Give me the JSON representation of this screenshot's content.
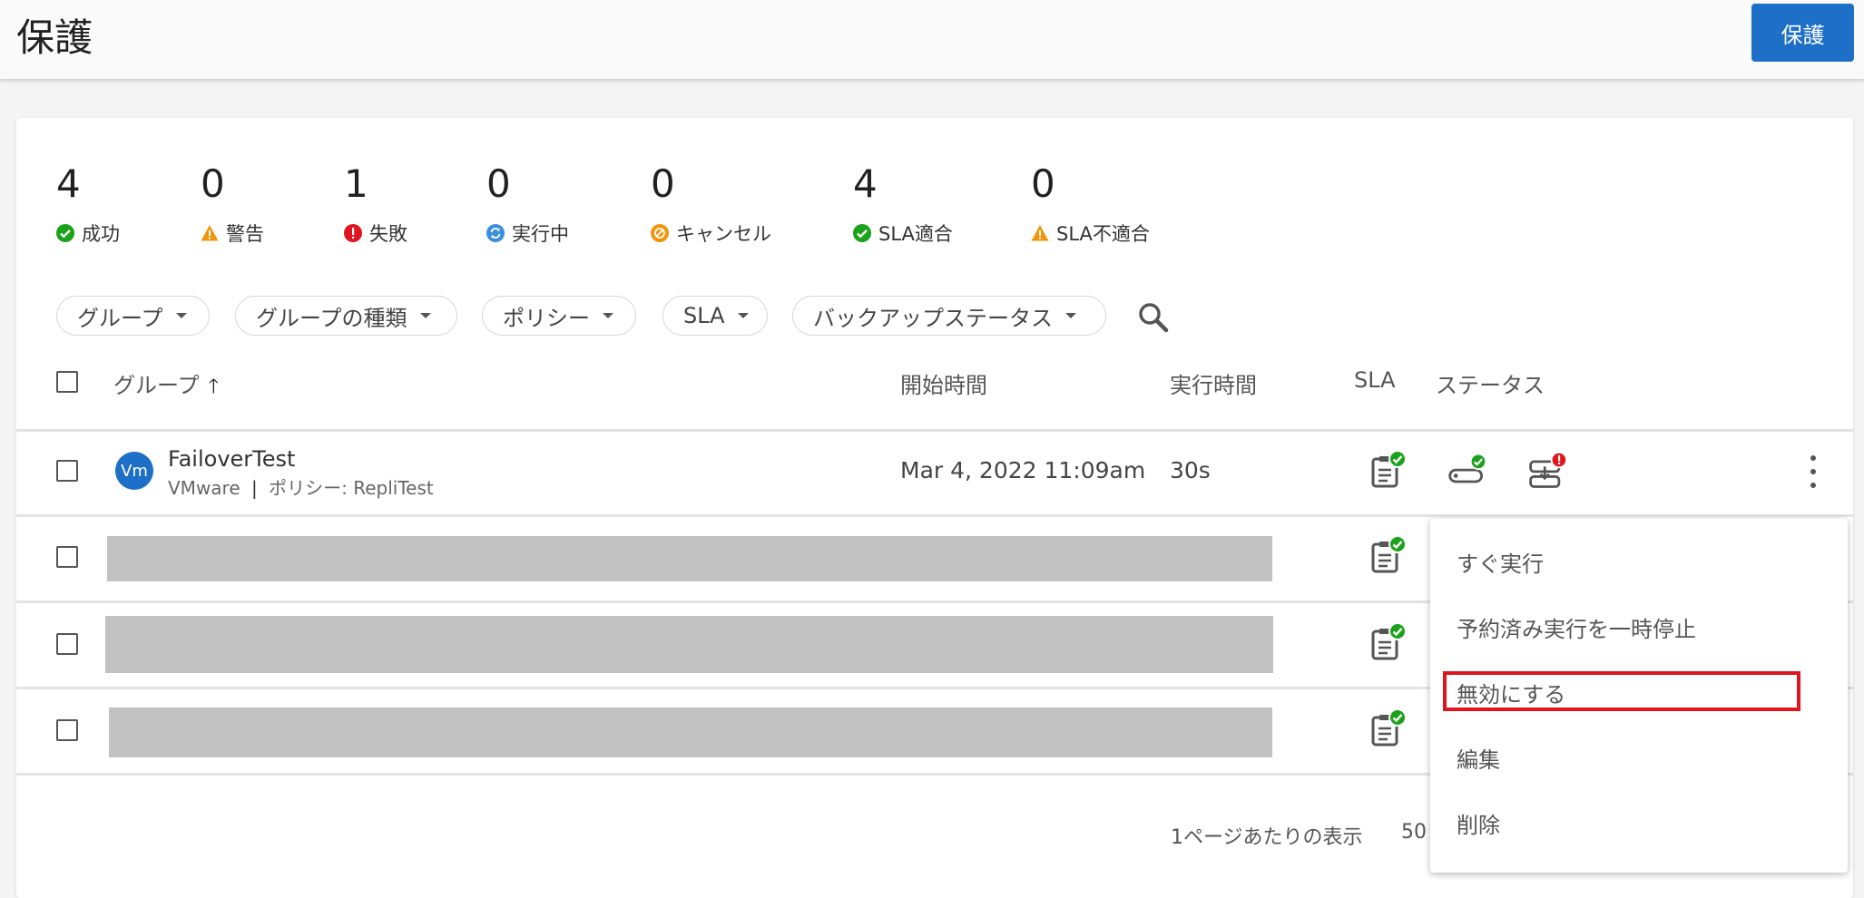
{
  "header": {
    "title": "保護",
    "protect_button": "保護",
    "brand_color": "#1d6fc7"
  },
  "stats": [
    {
      "value": "4",
      "label": "成功",
      "icon": "success-check-icon",
      "color": "#1aa31a"
    },
    {
      "value": "0",
      "label": "警告",
      "icon": "warning-icon",
      "color": "#f0960e"
    },
    {
      "value": "1",
      "label": "失敗",
      "icon": "error-icon",
      "color": "#e0151f"
    },
    {
      "value": "0",
      "label": "実行中",
      "icon": "running-sync-icon",
      "color": "#3d8fdb"
    },
    {
      "value": "0",
      "label": "キャンセル",
      "icon": "cancelled-icon",
      "color": "#f0960e"
    },
    {
      "value": "4",
      "label": "SLA適合",
      "icon": "sla-met-check-icon",
      "color": "#1aa31a"
    },
    {
      "value": "0",
      "label": "SLA不適合",
      "icon": "sla-not-met-warning-icon",
      "color": "#f0960e"
    }
  ],
  "filters": [
    "グループ",
    "グループの種類",
    "ポリシー",
    "SLA",
    "バックアップステータス"
  ],
  "table": {
    "headers": {
      "group": "グループ",
      "start_time": "開始時間",
      "run_time": "実行時間",
      "sla": "SLA",
      "status": "ステータス"
    },
    "rows": [
      {
        "avatar": "Vm",
        "name": "FailoverTest",
        "type": "VMware",
        "separator": "|",
        "policy": "ポリシー: RepliTest",
        "start_time": "Mar 4, 2022 11:09am",
        "run_time": "30s"
      }
    ]
  },
  "footer": {
    "per_page_label": "1ページあたりの表示",
    "per_page_value": "50"
  },
  "context_menu": {
    "items": [
      "すぐ実行",
      "予約済み実行を一時停止",
      "無効にする",
      "編集",
      "削除"
    ],
    "highlighted_index": 2,
    "highlight_color": "#e0151f"
  }
}
